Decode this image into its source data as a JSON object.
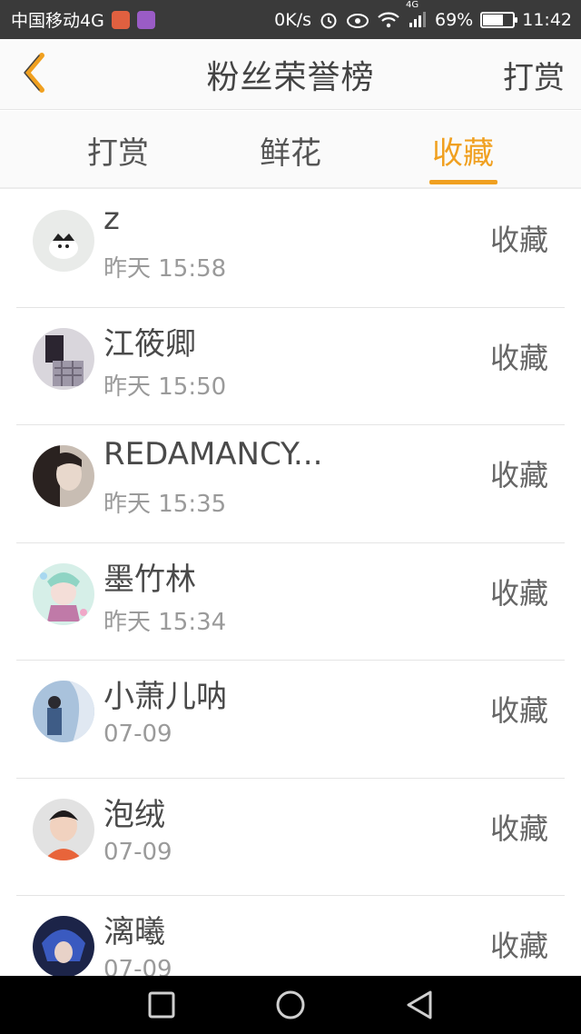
{
  "status_bar": {
    "carrier": "中国移动4G",
    "speed": "0K/s",
    "network": "4G",
    "battery_percent": "69%",
    "battery_level": 0.69,
    "time": "11:42"
  },
  "header": {
    "title": "粉丝荣誉榜",
    "right_action": "打赏",
    "back_icon": "chevron-left-icon"
  },
  "tabs": [
    {
      "label": "打赏",
      "active": false
    },
    {
      "label": "鲜花",
      "active": false
    },
    {
      "label": "收藏",
      "active": true
    }
  ],
  "colors": {
    "accent": "#f0a020",
    "status_bar_bg": "#3a3a3a",
    "nav_bar_bg": "#000000"
  },
  "fans": [
    {
      "name": "z",
      "time": "昨天 15:58",
      "action": "收藏"
    },
    {
      "name": "江筱卿",
      "time": "昨天 15:50",
      "action": "收藏"
    },
    {
      "name": "REDAMANCY...",
      "time": "昨天 15:35",
      "action": "收藏"
    },
    {
      "name": "墨竹林",
      "time": "昨天 15:34",
      "action": "收藏"
    },
    {
      "name": "小萧儿呐",
      "time": "07-09",
      "action": "收藏"
    },
    {
      "name": "泡绒",
      "time": "07-09",
      "action": "收藏"
    },
    {
      "name": "漓曦",
      "time": "07-09",
      "action": "收藏"
    }
  ]
}
